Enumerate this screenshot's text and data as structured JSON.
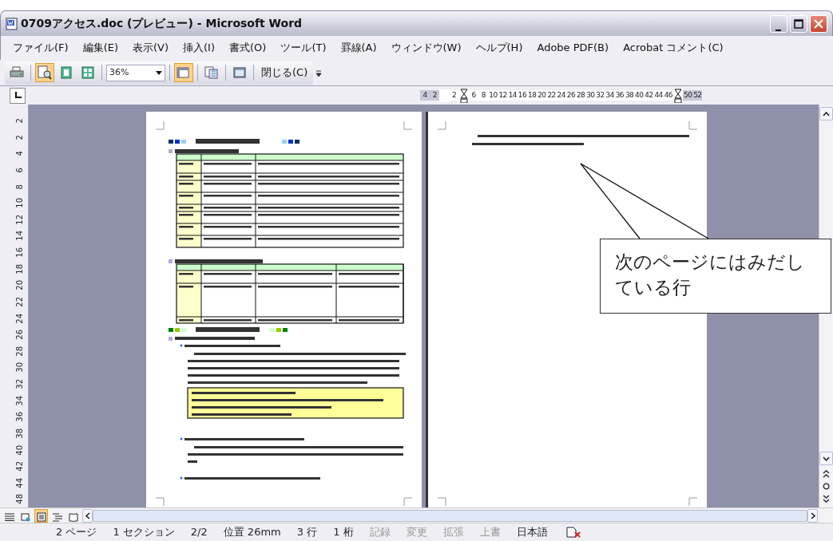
{
  "window": {
    "title": "0709アクセス.doc (プレビュー) - Microsoft Word"
  },
  "menu": [
    "ファイル(F)",
    "編集(E)",
    "表示(V)",
    "挿入(I)",
    "書式(O)",
    "ツール(T)",
    "罫線(A)",
    "ウィンドウ(W)",
    "ヘルプ(H)",
    "Adobe PDF(B)",
    "Acrobat コメント(C)"
  ],
  "toolbar": {
    "magnifier_on": true,
    "zoom": "36%",
    "ruler_on": true,
    "close_label": "閉じる(C)"
  },
  "ruler": [
    {
      "kind": "label",
      "label": "4"
    },
    {
      "kind": "label",
      "label": "2"
    },
    {
      "kind": "blank"
    },
    {
      "kind": "label",
      "label": "2"
    },
    {
      "kind": "indent"
    },
    {
      "kind": "label",
      "label": "6"
    },
    {
      "kind": "label",
      "label": "8"
    },
    {
      "kind": "label",
      "label": "10"
    },
    {
      "kind": "label",
      "label": "12"
    },
    {
      "kind": "label",
      "label": "14"
    },
    {
      "kind": "label",
      "label": "16"
    },
    {
      "kind": "label",
      "label": "18"
    },
    {
      "kind": "label",
      "label": "20"
    },
    {
      "kind": "label",
      "label": "22"
    },
    {
      "kind": "label",
      "label": "24"
    },
    {
      "kind": "label",
      "label": "26"
    },
    {
      "kind": "label",
      "label": "28"
    },
    {
      "kind": "label",
      "label": "30"
    },
    {
      "kind": "label",
      "label": "32"
    },
    {
      "kind": "label",
      "label": "34"
    },
    {
      "kind": "label",
      "label": "36"
    },
    {
      "kind": "label",
      "label": "38"
    },
    {
      "kind": "label",
      "label": "40"
    },
    {
      "kind": "label",
      "label": "42"
    },
    {
      "kind": "label",
      "label": "44"
    },
    {
      "kind": "label",
      "label": "46"
    },
    {
      "kind": "indent"
    },
    {
      "kind": "label",
      "label": "50"
    },
    {
      "kind": "label",
      "label": "52"
    }
  ],
  "vertical_ruler": [
    "2",
    "2",
    "4",
    "6",
    "8",
    "10",
    "12",
    "14",
    "16",
    "18",
    "20",
    "22",
    "24",
    "26",
    "28",
    "30",
    "32",
    "34",
    "36",
    "38",
    "40",
    "42",
    "44",
    "48"
  ],
  "callout": "次のページにはみだしている行",
  "status_bar": [
    {
      "text": "2 ページ",
      "disabled": false
    },
    {
      "text": "1 セクション",
      "disabled": false
    },
    {
      "text": "2/2",
      "disabled": false
    },
    {
      "text": "位置 26mm",
      "disabled": false
    },
    {
      "text": "3 行",
      "disabled": false
    },
    {
      "text": "1 桁",
      "disabled": false
    },
    {
      "text": "記録",
      "disabled": true
    },
    {
      "text": "変更",
      "disabled": true
    },
    {
      "text": "拡張",
      "disabled": true
    },
    {
      "text": "上書",
      "disabled": true
    },
    {
      "text": "日本語",
      "disabled": false
    }
  ]
}
